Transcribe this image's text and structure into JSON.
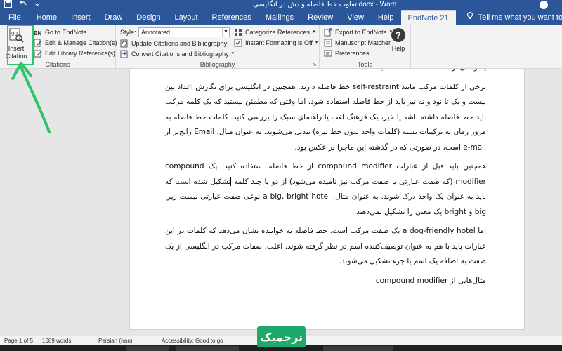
{
  "titlebar": {
    "title": "تفاوت خط فاصله و دش در انگلیسی.docx - Word"
  },
  "tabs": [
    "File",
    "Home",
    "Insert",
    "Draw",
    "Design",
    "Layout",
    "References",
    "Mailings",
    "Review",
    "View",
    "Help",
    "EndNote 21"
  ],
  "tell_me": "Tell me what you want to do",
  "ribbon": {
    "citations": {
      "label": "Citations",
      "insert_citation": "Insert Citation",
      "go_to_endnote": "Go to EndNote",
      "edit_manage": "Edit & Manage Citation(s)",
      "edit_library": "Edit Library Reference(s)"
    },
    "bibliography": {
      "label": "Bibliography",
      "style_label": "Style:",
      "style_value": "Annotated",
      "update": "Update Citations and Bibliography",
      "convert": "Convert Citations and Bibliography",
      "categorize": "Categorize References",
      "instant": "Instant Formatting is Off"
    },
    "tools": {
      "label": "Tools",
      "export": "Export to EndNote",
      "manuscript": "Manuscript Matcher",
      "preferences": "Preferences",
      "help": "Help"
    }
  },
  "document": {
    "partial_line": "یه زمانی از خط فاصله استفاده کنیم!",
    "p1": "برخی از کلمات مرکب مانند self-restraint خط فاصله دارند. همچنین در انگلیسی برای نگارش اعداد بین بیست و یک تا نود و نه نیز باید از خط فاصله استفاده شود. اما وقتی که مطمئن نیستید که یک کلمه مرکب باید خط فاصله داشته باشد یا خیر، یک فرهنگ لغت یا راهنمای سبک را بررسی کنید. کلمات خط فاصله به مرور زمان به ترکیبات بسته (کلمات واحد بدون خط تیره) تبدیل می‌شوند. به عنوان مثال، Email رایج‌تر از e-mail است، در صورتی که در گذشته این ماجرا بر عکس بود.",
    "p2a": "همچنین باید قبل از عبارات compound modifier از خط فاصله استفاده کنید. یک compound modifier (که صفت عبارتی یا صفت مرکب نیز نامیده می‌شود) از دو یا چند کلمه",
    "p2b": "تشکیل شده است که باید به عنوان یک واحد درک شوند. به عنوان مثال، a big, bright hotel نوعی صفت عبارتی نیست زیرا big و bright یک معنی را تشکیل نمی‌دهند.",
    "p3": "اما a dog-friendly hotel یک صفت مرکب است. خط فاصله به خواننده نشان می‌دهد که کلمات در این عبارات باید با هم به عنوان توصیف‌کننده اسم در نظر گرفته شوند. اغلب، صفات مرکب در انگلیسی از یک صفت به اضافه یک اسم یا جزء تشکیل می‌شوند.",
    "p4": "مثال‌هایی از compound modifier"
  },
  "status": {
    "page": "Page 1 of 5",
    "words": "1089 words",
    "language": "Persian (Iran)",
    "accessibility": "Accessibility: Good to go"
  },
  "badge": "ترجمیک",
  "colors": {
    "word_blue": "#2b579a",
    "annotation_green": "#2fc46a",
    "badge_green": "#1ea86a"
  }
}
